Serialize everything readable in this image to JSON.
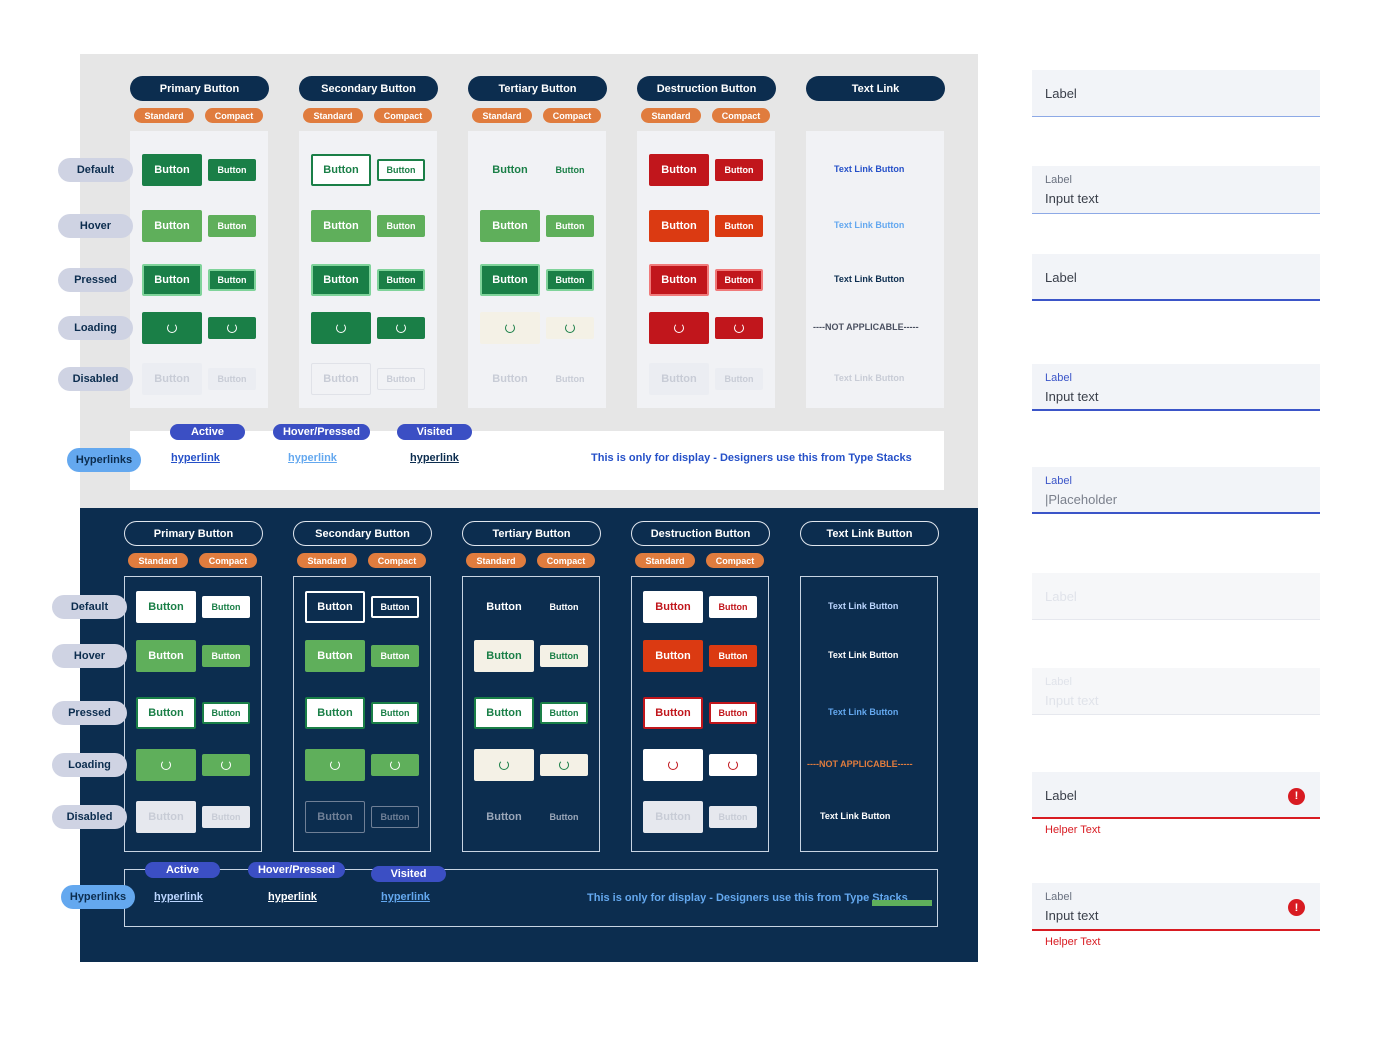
{
  "colors": {
    "navy": "#0c2d4f",
    "green": "#1a7f47",
    "green_light": "#5faf5b",
    "red": "#c1161c",
    "red_orange": "#db3a12",
    "orange_tag": "#e07c3e",
    "link_blue": "#2550c8",
    "error": "#d81b22"
  },
  "columns": [
    "Primary Button",
    "Secondary Button",
    "Tertiary Button",
    "Destruction Button",
    "Text Link"
  ],
  "dark_columns": [
    "Primary Button",
    "Secondary Button",
    "Tertiary Button",
    "Destruction Button",
    "Text Link Button"
  ],
  "tags": {
    "standard": "Standard",
    "compact": "Compact"
  },
  "states": [
    "Default",
    "Hover",
    "Pressed",
    "Loading",
    "Disabled"
  ],
  "button_label": "Button",
  "text_link_label": "Text Link Button",
  "not_applicable": "----NOT APPLICABLE-----",
  "hyperlinks": {
    "label": "Hyperlinks",
    "states": [
      "Active",
      "Hover/Pressed",
      "Visited"
    ],
    "link_text": "hyperlink",
    "note": "This is only for display - Designers use this from Type Stacks"
  },
  "fields": [
    {
      "label": "Label",
      "value": "",
      "variant": "empty"
    },
    {
      "label": "Label",
      "value": "Input text",
      "variant": "filled"
    },
    {
      "label": "Label",
      "value": "",
      "variant": "focused-empty"
    },
    {
      "label": "Label",
      "value": "Input text",
      "variant": "focused-filled"
    },
    {
      "label": "Label",
      "value": "|Placeholder",
      "variant": "placeholder"
    },
    {
      "label": "Label",
      "value": "",
      "variant": "disabled-empty"
    },
    {
      "label": "Label",
      "value": "Input text",
      "variant": "disabled-filled"
    },
    {
      "label": "Label",
      "value": "",
      "variant": "error-empty",
      "helper": "Helper Text",
      "error_icon": "!"
    },
    {
      "label": "Label",
      "value": "Input text",
      "variant": "error-filled",
      "helper": "Helper Text",
      "error_icon": "!"
    }
  ]
}
